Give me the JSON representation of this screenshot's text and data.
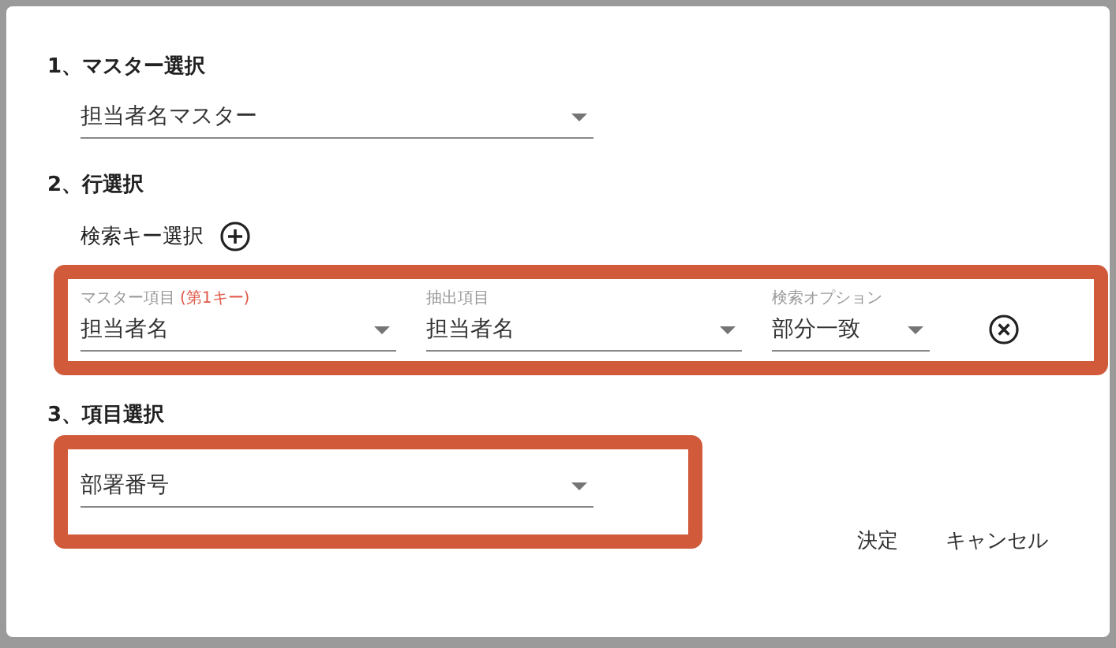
{
  "master_section": {
    "heading": "1、マスター選択",
    "select": {
      "value": "担当者名マスター"
    }
  },
  "row_section": {
    "heading": "2、行選択",
    "search_key_label": "検索キー選択",
    "fields": [
      {
        "label": "マスター項目",
        "note": "(第1キー)",
        "value": "担当者名"
      },
      {
        "label": "抽出項目",
        "value": "担当者名"
      },
      {
        "label": "検索オプション",
        "value": "部分一致"
      }
    ]
  },
  "item_section": {
    "heading": "3、項目選択",
    "select": {
      "value": "部署番号"
    }
  },
  "buttons": [
    "決定",
    "キャンセル"
  ]
}
